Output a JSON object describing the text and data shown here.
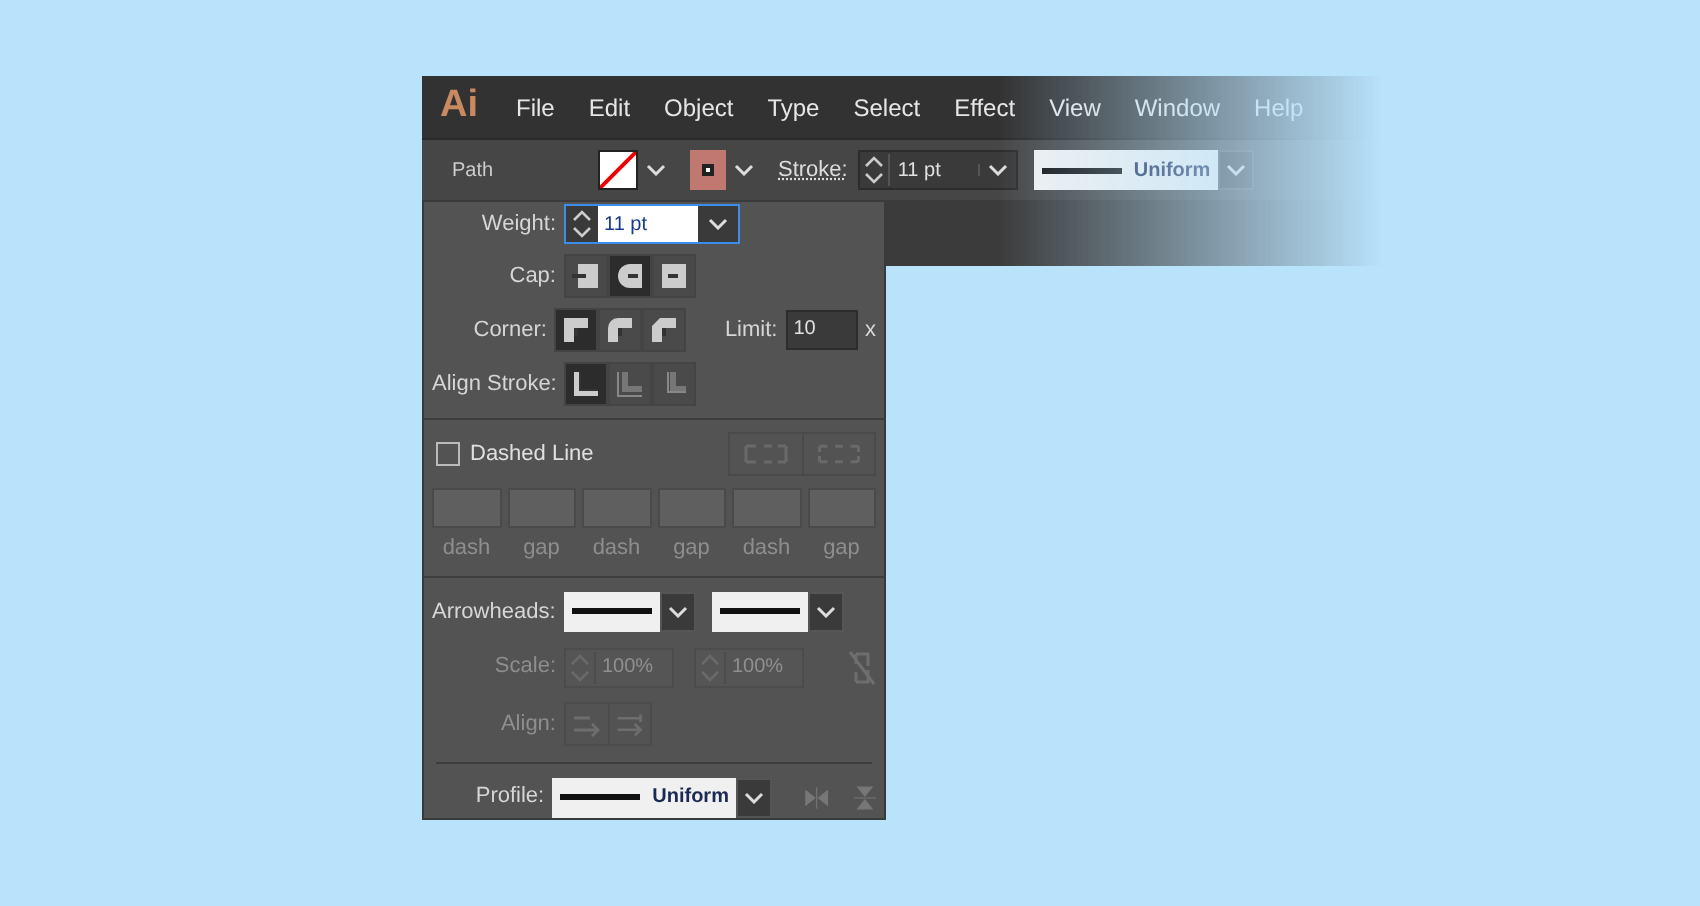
{
  "menu_bar": {
    "logo": "Ai",
    "items": [
      "File",
      "Edit",
      "Object",
      "Type",
      "Select",
      "Effect",
      "View",
      "Window",
      "Help"
    ]
  },
  "control_bar": {
    "label": "Path",
    "stroke_label": "Stroke:",
    "stroke_weight": "11 pt",
    "profile": "Uniform"
  },
  "stroke_panel": {
    "weight": {
      "label": "Weight:",
      "value": "11 pt"
    },
    "cap": {
      "label": "Cap:",
      "options": [
        {
          "kind": "butt",
          "selected": false
        },
        {
          "kind": "round",
          "selected": true
        },
        {
          "kind": "projecting",
          "selected": false
        }
      ]
    },
    "corner": {
      "label": "Corner:",
      "options": [
        {
          "kind": "miter",
          "selected": true
        },
        {
          "kind": "round",
          "selected": false
        },
        {
          "kind": "bevel",
          "selected": false
        }
      ],
      "limit_label": "Limit:",
      "limit": "10",
      "limit_unit": "x"
    },
    "align_stroke": {
      "label": "Align Stroke:",
      "options": [
        {
          "kind": "center",
          "selected": true
        },
        {
          "kind": "inside",
          "selected": false
        },
        {
          "kind": "outside",
          "selected": false
        }
      ]
    },
    "dashed_line": {
      "label": "Dashed Line",
      "checked": false
    },
    "dash_fields": [
      {
        "label": "dash"
      },
      {
        "label": "gap"
      },
      {
        "label": "dash"
      },
      {
        "label": "gap"
      },
      {
        "label": "dash"
      },
      {
        "label": "gap"
      }
    ],
    "arrowheads": {
      "label": "Arrowheads:"
    },
    "scale": {
      "label": "Scale:",
      "values": [
        "100%",
        "100%"
      ],
      "disabled": true
    },
    "align": {
      "label": "Align:",
      "disabled": true
    },
    "profile": {
      "label": "Profile:",
      "value": "Uniform"
    }
  }
}
